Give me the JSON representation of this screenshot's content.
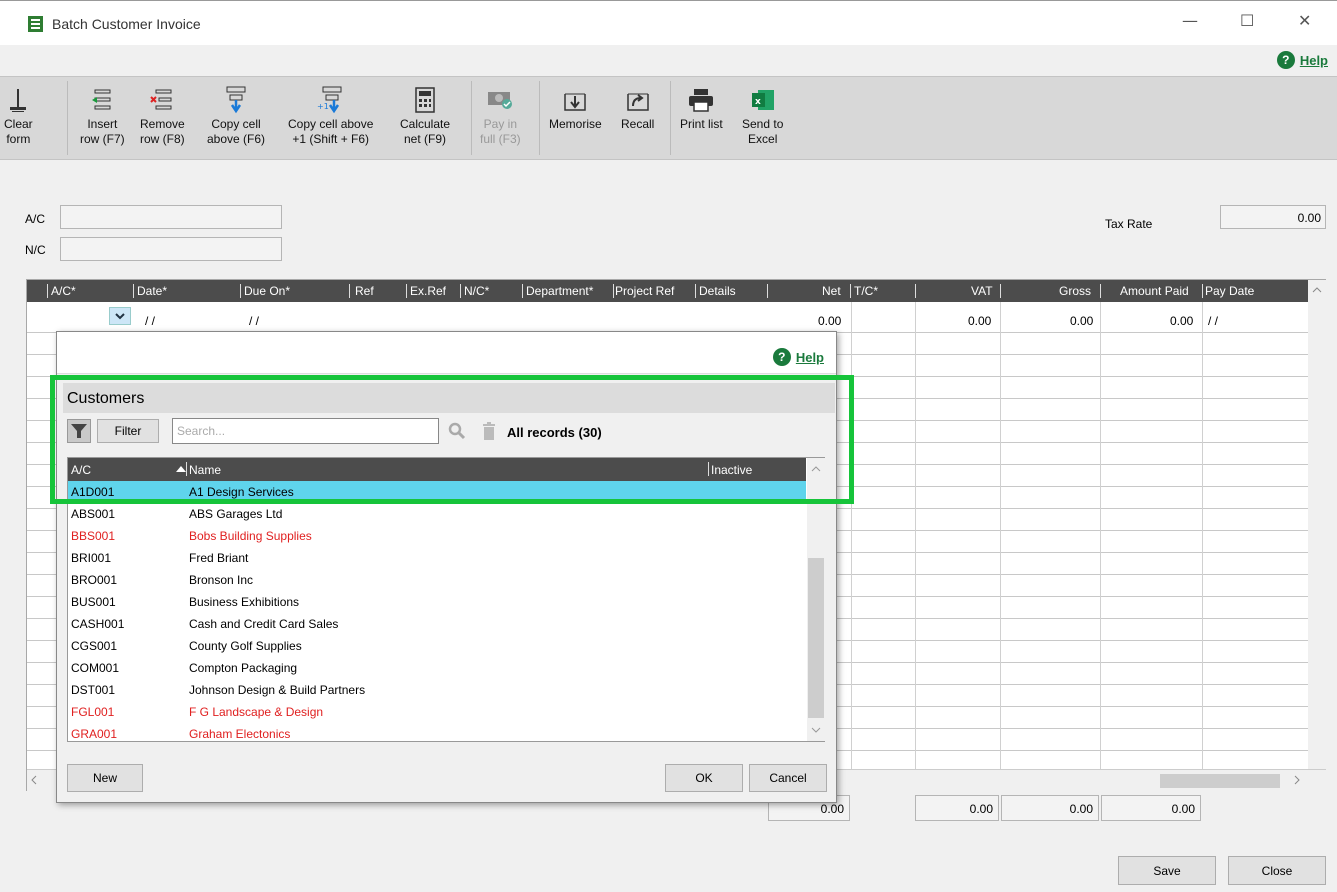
{
  "window": {
    "title": "Batch Customer Invoice",
    "minimize": "—",
    "maximize": "☐",
    "close": "✕"
  },
  "help": {
    "icon": "?",
    "label": "Help"
  },
  "toolbar": {
    "clear": [
      "Clear",
      "form"
    ],
    "insert": [
      "Insert",
      "row (F7)"
    ],
    "remove": [
      "Remove",
      "row (F8)"
    ],
    "copy_cell": [
      "Copy cell",
      "above (F6)"
    ],
    "copy_cell_plus": [
      "Copy cell above",
      "+1 (Shift + F6)"
    ],
    "calc_net": [
      "Calculate",
      "net (F9)"
    ],
    "pay_full": [
      "Pay in",
      "full (F3)"
    ],
    "memorise": "Memorise",
    "recall": "Recall",
    "print": "Print list",
    "excel": [
      "Send to",
      "Excel"
    ]
  },
  "form": {
    "ac_label": "A/C",
    "nc_label": "N/C",
    "tax_label": "Tax Rate",
    "tax_value": "0.00"
  },
  "grid": {
    "columns": [
      "A/C*",
      "Date*",
      "Due On*",
      "Ref",
      "Ex.Ref",
      "N/C*",
      "Department*",
      "Project Ref",
      "Details",
      "Net",
      "T/C*",
      "VAT",
      "Gross",
      "Amount Paid",
      "Pay Date"
    ],
    "row": {
      "date": "/ /",
      "due": "/ /",
      "net": "0.00",
      "vat": "0.00",
      "gross": "0.00",
      "paid": "0.00",
      "paydate": "/ /"
    }
  },
  "totals": {
    "net": "0.00",
    "vat": "0.00",
    "gross": "0.00",
    "paid": "0.00"
  },
  "buttons": {
    "save": "Save",
    "close": "Close"
  },
  "dialog": {
    "help": "Help",
    "title": "Customers",
    "filter": "Filter",
    "search_placeholder": "Search...",
    "records": "All records (30)",
    "columns": {
      "ac": "A/C",
      "name": "Name",
      "inactive": "Inactive"
    },
    "rows": [
      {
        "ac": "A1D001",
        "name": "A1 Design Services"
      },
      {
        "ac": "ABS001",
        "name": "ABS Garages Ltd"
      },
      {
        "ac": "BBS001",
        "name": "Bobs Building Supplies"
      },
      {
        "ac": "BRI001",
        "name": "Fred Briant"
      },
      {
        "ac": "BRO001",
        "name": "Bronson Inc"
      },
      {
        "ac": "BUS001",
        "name": "Business Exhibitions"
      },
      {
        "ac": "CASH001",
        "name": "Cash and Credit Card Sales"
      },
      {
        "ac": "CGS001",
        "name": "County Golf Supplies"
      },
      {
        "ac": "COM001",
        "name": "Compton Packaging"
      },
      {
        "ac": "DST001",
        "name": "Johnson Design & Build Partners"
      },
      {
        "ac": "FGL001",
        "name": "F G Landscape & Design"
      },
      {
        "ac": "GRA001",
        "name": "Graham Electonics"
      }
    ],
    "new": "New",
    "ok": "OK",
    "cancel": "Cancel"
  },
  "colors": {
    "selected_row": "#5fd4ec",
    "inactive_text": "#e02020",
    "highlight": "#16c43a",
    "help": "#1a7a3c"
  }
}
